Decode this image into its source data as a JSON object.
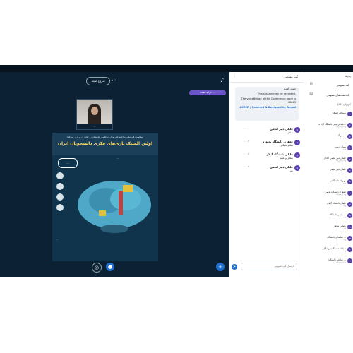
{
  "header": {
    "record_button": "شروع ضبط",
    "stage_title": "تیتر"
  },
  "presenter_badge": "ارائه دهنده: ...",
  "camera": {
    "caption": "..."
  },
  "poster": {
    "top_line": "معاونت فرهنگی و اجتماعی وزارت علوم، تحقیقات و فناوری برگزار می‌کند:",
    "title": "اولین المپیک بازی‌های فکری دانشجویان ایران",
    "subtitle": "...",
    "logo": "...",
    "info": "..."
  },
  "chat": {
    "title": "گپ عمومی",
    "welcome": [
      "خوش آمدید",
      "This session may be recorded.",
      "The voiceBridge of this Conference room is 48643",
      "ACECR | Powered & Designed by Amjad"
    ],
    "messages": [
      {
        "avatar": "جا",
        "name": "جلیلی دبیر انجمن",
        "time": "۱۰:۰۰",
        "text": "سلام"
      },
      {
        "avatar": "جد",
        "name": "جعفری دانشگاه بجنورد",
        "time": "۱۰:۰۲",
        "text": "سلام علیکم"
      },
      {
        "avatar": "خد",
        "name": "خلیلی دانشگاه گیلان",
        "time": "۱۰:۰۳",
        "text": "سلام بر همه"
      },
      {
        "avatar": "جا",
        "name": "جلیلی دبیر انجمن",
        "time": "۱۰:۰۴",
        "text": "بله"
      }
    ],
    "input_placeholder": "ارسال گپ عمومی"
  },
  "users": {
    "messages_section": "پیام‌ها",
    "nav": [
      {
        "label": "گپ عمومی",
        "icon": "chat-icon"
      },
      {
        "label": "یادداشت‌های عمومی",
        "icon": "notes-icon"
      }
    ],
    "count_label": "کاربران (24)",
    "list": [
      {
        "avatar": "سا",
        "name": "سیدالله الصلاة",
        "status": ""
      },
      {
        "avatar": "عا",
        "name": "عبدالرحیمی دانشگاه آزاد ب...",
        "status": "وب | پذیرفته"
      },
      {
        "avatar": "بج",
        "name": "بهرنگ ...",
        "status": "وب"
      },
      {
        "avatar": "پا",
        "name": "پیمان آزمون",
        "status": "وب"
      },
      {
        "avatar": "جا",
        "name": "جلیلی دبیر انجمن آبادان",
        "status": "وب | پذیرفته"
      },
      {
        "avatar": "جا",
        "name": "جلیلی دبیر انجمن",
        "status": ""
      },
      {
        "avatar": "ما",
        "name": "مهرداد دانشگاهی",
        "status": "وب"
      },
      {
        "avatar": "جد",
        "name": "جعفری دانشگاه بجنورد",
        "status": "وب | پذیرفته"
      },
      {
        "avatar": "خد",
        "name": "خلیلی دانشگاه گیلان",
        "status": "وب"
      },
      {
        "avatar": "مد",
        "name": "معینی دانشگاه ...",
        "status": "وب"
      },
      {
        "avatar": "رش",
        "name": "رضایی شاهد",
        "status": "وب"
      },
      {
        "avatar": "سد",
        "name": "سلیمانی دانشگاه ...",
        "status": "وب"
      },
      {
        "avatar": "عا",
        "name": "عبدالله دانشگاه فرهنگیان",
        "status": "وب"
      },
      {
        "avatar": "صد",
        "name": "صادقی دانشگاه ...",
        "status": "وب | پذیرفته"
      }
    ]
  },
  "colors": {
    "stage_bg": "#0c2133",
    "accent": "#1f6fd1",
    "avatar": "#5b3fb0",
    "presenter_pill": "#6b56c9"
  }
}
